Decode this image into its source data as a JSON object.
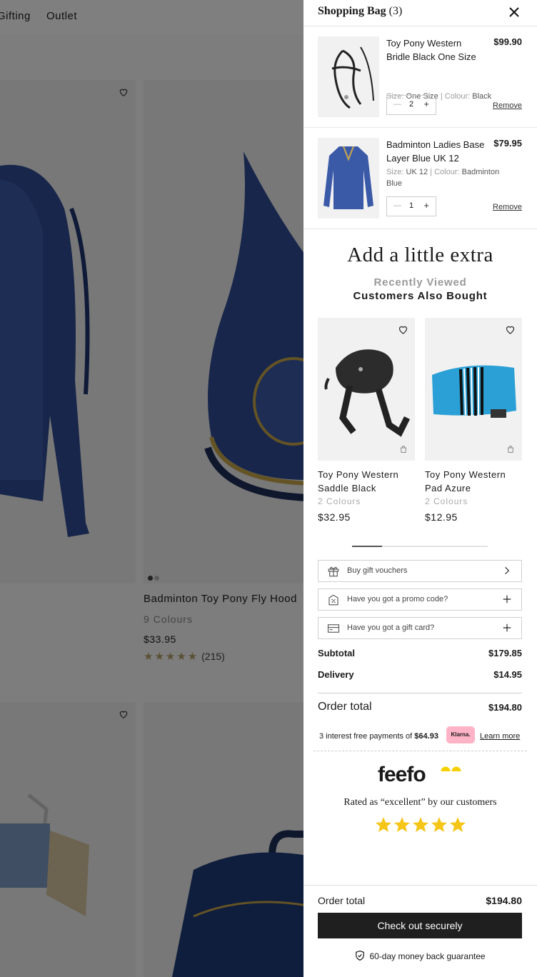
{
  "background": {
    "nav": [
      "Gifting",
      "Outlet"
    ],
    "product": {
      "name": "Badminton Toy Pony Fly Hood",
      "colours": "9 Colours",
      "price": "$33.95",
      "stars": "★★★★★",
      "reviews": "(215)"
    }
  },
  "bag": {
    "title": "Shopping Bag",
    "count": "(3)",
    "items": [
      {
        "name": "Toy Pony Western Bridle Black One Size",
        "price": "$99.90",
        "size_label": "Size:",
        "size": "One Size",
        "colour_label": "Colour:",
        "colour": "Black",
        "qty": "2",
        "remove": "Remove"
      },
      {
        "name": "Badminton Ladies Base Layer Blue UK 12",
        "price": "$79.95",
        "size_label": "Size:",
        "size": "UK 12",
        "colour_label": "Colour:",
        "colour": "Badminton Blue",
        "qty": "1",
        "remove": "Remove"
      }
    ]
  },
  "extra": {
    "title": "Add a little extra",
    "tabs": [
      "Recently Viewed",
      "Customers Also Bought"
    ],
    "products": [
      {
        "name": "Toy Pony Western Saddle Black",
        "colours": "2 Colours",
        "price": "$32.95"
      },
      {
        "name": "Toy Pony Western Pad Azure",
        "colours": "2 Colours",
        "price": "$12.95"
      }
    ]
  },
  "actions": {
    "gift_vouchers": "Buy gift vouchers",
    "promo": "Have you got a promo code?",
    "gift_card": "Have you got a gift card?"
  },
  "totals": {
    "subtotal_label": "Subtotal",
    "subtotal": "$179.85",
    "delivery_label": "Delivery",
    "delivery": "$14.95",
    "order_label": "Order total",
    "order": "$194.80"
  },
  "klarna": {
    "text": "3 interest free payments of",
    "amount": "$64.93",
    "badge": "Klarna.",
    "learn_more": "Learn more"
  },
  "feefo": {
    "logo": "feefo",
    "rating_text": "Rated as “excellent” by our customers"
  },
  "sticky": {
    "order_label": "Order total",
    "order": "$194.80",
    "checkout": "Check out securely",
    "guarantee": "60-day money back guarantee"
  },
  "colors": {
    "overlay": "rgba(0,0,0,0.5)",
    "brand_blue": "#2f4c94",
    "checkout_bg": "#1f1f1f",
    "star_yellow": "#f5c518",
    "klarna_pink": "#ffb3c7"
  }
}
